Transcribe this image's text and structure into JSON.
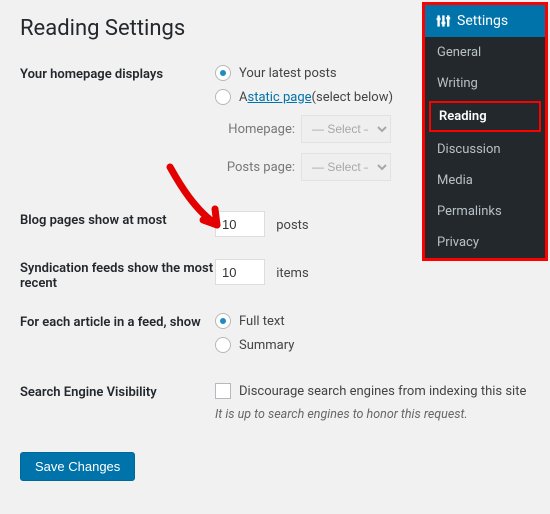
{
  "title": "Reading Settings",
  "homepage": {
    "label": "Your homepage displays",
    "opt_latest": "Your latest posts",
    "opt_static_prefix": "A ",
    "opt_static_link": "static page",
    "opt_static_suffix": " (select below)",
    "homepage_label": "Homepage:",
    "postspage_label": "Posts page:",
    "select_placeholder": "— Select —"
  },
  "blog_pages": {
    "label": "Blog pages show at most",
    "value": "10",
    "unit": "posts"
  },
  "syndication": {
    "label": "Syndication feeds show the most recent",
    "value": "10",
    "unit": "items"
  },
  "feed_article": {
    "label": "For each article in a feed, show",
    "opt_full": "Full text",
    "opt_summary": "Summary"
  },
  "search_vis": {
    "label": "Search Engine Visibility",
    "checkbox": "Discourage search engines from indexing this site",
    "hint": "It is up to search engines to honor this request."
  },
  "save_label": "Save Changes",
  "sidebar": {
    "header": "Settings",
    "items": [
      "General",
      "Writing",
      "Reading",
      "Discussion",
      "Media",
      "Permalinks",
      "Privacy"
    ]
  }
}
